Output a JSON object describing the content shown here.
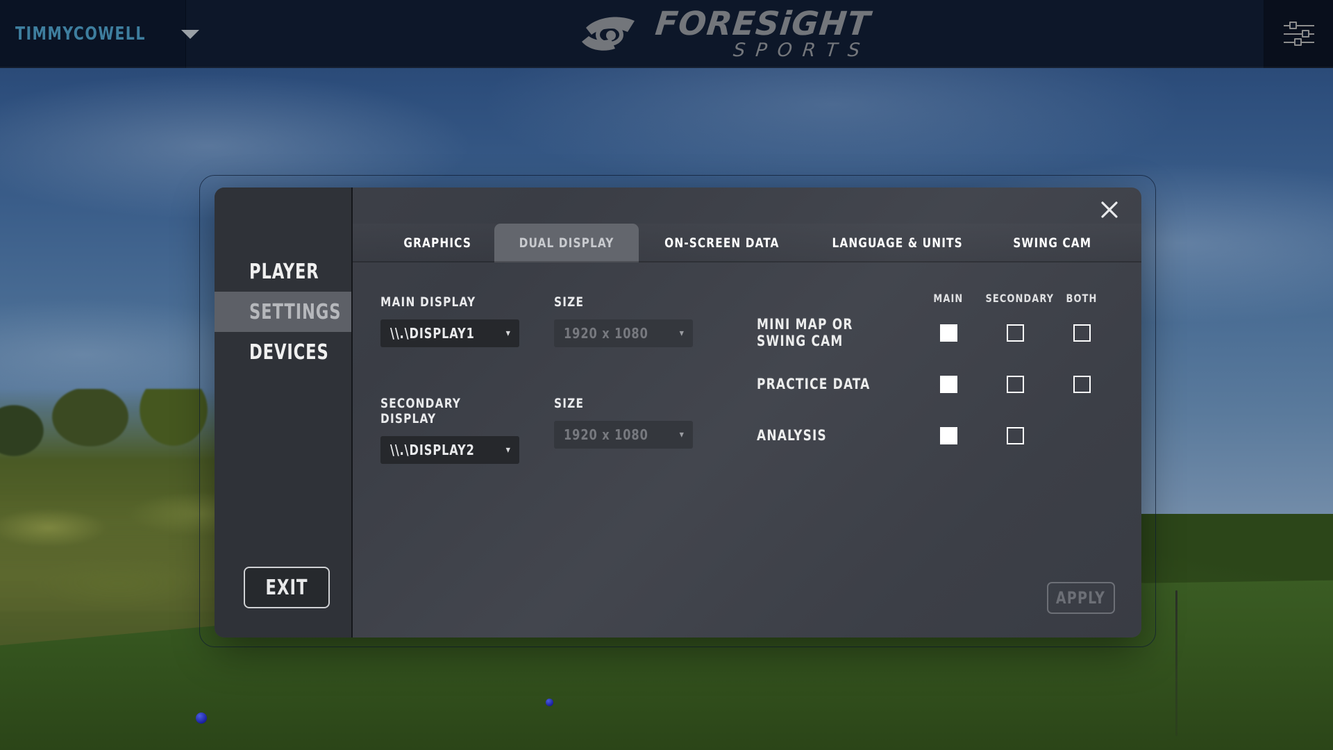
{
  "topbar": {
    "username": "TIMMYCOWELL",
    "user_caret_icon": "chevron-down-icon",
    "logo_primary": "FORESiGHT",
    "logo_secondary": "SPORTS",
    "settings_icon": "sliders-icon"
  },
  "sidebar": {
    "items": [
      {
        "label": "PLAYER",
        "active": false
      },
      {
        "label": "SETTINGS",
        "active": true
      },
      {
        "label": "DEVICES",
        "active": false
      }
    ],
    "exit_label": "EXIT"
  },
  "dialog": {
    "close_icon": "close-icon",
    "tabs": [
      {
        "label": "GRAPHICS",
        "active": false
      },
      {
        "label": "DUAL DISPLAY",
        "active": true
      },
      {
        "label": "ON-SCREEN DATA",
        "active": false
      },
      {
        "label": "LANGUAGE & UNITS",
        "active": false
      },
      {
        "label": "SWING CAM",
        "active": false
      }
    ],
    "apply_label": "APPLY",
    "apply_disabled": true
  },
  "display_settings": {
    "main_display": {
      "label": "MAIN DISPLAY",
      "value": "\\\\.\\DISPLAY1",
      "disabled": false
    },
    "main_size": {
      "label": "SIZE",
      "value": "1920 x 1080",
      "disabled": true
    },
    "secondary_display": {
      "label": "SECONDARY DISPLAY",
      "value": "\\\\.\\DISPLAY2",
      "disabled": false
    },
    "secondary_size": {
      "label": "SIZE",
      "value": "1920 x 1080",
      "disabled": true
    }
  },
  "assignment_table": {
    "columns": [
      "MAIN",
      "SECONDARY",
      "BOTH"
    ],
    "rows": [
      {
        "label": "MINI MAP OR SWING CAM",
        "main": "checked",
        "secondary": "unchecked",
        "both": "unchecked"
      },
      {
        "label": "PRACTICE DATA",
        "main": "checked",
        "secondary": "unchecked",
        "both": "unchecked"
      },
      {
        "label": "ANALYSIS",
        "main": "checked",
        "secondary": "unchecked",
        "both": "none"
      }
    ]
  },
  "colors": {
    "accent_username": "#3e7e9e",
    "topbar_bg": "#0d1729",
    "modal_bg": "#3e4149",
    "nav_bg": "#2f3238",
    "nav_active": "#5d6067",
    "tab_active": "#63666d",
    "checkbox": "#ffffff",
    "disabled_text": "#77797f"
  }
}
